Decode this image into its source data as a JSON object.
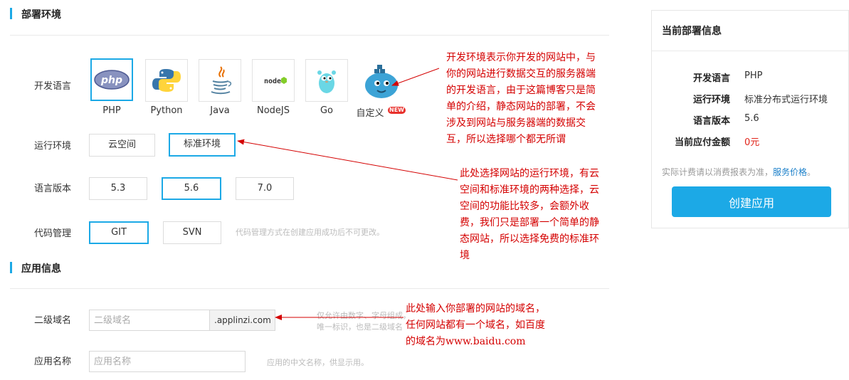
{
  "deploy": {
    "title": "部署环境",
    "language": {
      "label": "开发语言",
      "options": [
        {
          "name": "PHP",
          "icon": "php-logo-icon",
          "selected": true
        },
        {
          "name": "Python",
          "icon": "python-logo-icon",
          "selected": false
        },
        {
          "name": "Java",
          "icon": "java-logo-icon",
          "selected": false
        },
        {
          "name": "NodeJS",
          "icon": "nodejs-logo-icon",
          "selected": false
        },
        {
          "name": "Go",
          "icon": "go-gopher-icon",
          "selected": false
        },
        {
          "name": "自定义",
          "icon": "docker-whale-icon",
          "selected": false,
          "badge": "NEW"
        }
      ]
    },
    "runtime": {
      "label": "运行环境",
      "options": [
        {
          "name": "云空间",
          "selected": false
        },
        {
          "name": "标准环境",
          "selected": true
        }
      ]
    },
    "version": {
      "label": "语言版本",
      "options": [
        {
          "name": "5.3",
          "selected": false
        },
        {
          "name": "5.6",
          "selected": true
        },
        {
          "name": "7.0",
          "selected": false
        }
      ]
    },
    "vcs": {
      "label": "代码管理",
      "options": [
        {
          "name": "GIT",
          "selected": true
        },
        {
          "name": "SVN",
          "selected": false
        }
      ],
      "hint": "代码管理方式在创建应用成功后不可更改。"
    }
  },
  "app": {
    "title": "应用信息",
    "domain": {
      "label": "二级域名",
      "placeholder": "二级域名",
      "suffix": ".applinzi.com",
      "hint_line1": "仅允许由数字、字母组成，",
      "hint_line2": "唯一标识，也是二级域名"
    },
    "name": {
      "label": "应用名称",
      "placeholder": "应用名称",
      "hint": "应用的中文名称，供显示用。"
    }
  },
  "summary": {
    "title": "当前部署信息",
    "rows": [
      {
        "label": "开发语言",
        "value": "PHP"
      },
      {
        "label": "运行环境",
        "value": "标准分布式运行环境"
      },
      {
        "label": "语言版本",
        "value": "5.6"
      },
      {
        "label": "当前应付金额",
        "value": "0元"
      }
    ],
    "note_prefix": "实际计费请以消费报表为准，",
    "note_link": "服务价格",
    "note_suffix": "。",
    "create_button": "创建应用"
  },
  "annotations": {
    "lang": [
      "开发环境表示你开发的网站中，与",
      "你的网站进行数据交互的服务器端",
      "的开发语言，由于这篇博客只是简",
      "单的介绍，静态网站的部署，不会",
      "涉及到网站与服务器端的数据交",
      "互，所以选择哪个都无所谓"
    ],
    "runtime": [
      "此处选择网站的运行环境，有云",
      "空间和标准环境的两种选择，云",
      "空间的功能比较多，会额外收",
      "费，我们只是部署一个简单的静",
      "态网站，所以选择免费的标准环",
      "境"
    ],
    "domain": [
      "此处输入你部署的网站的域名，",
      "任何网站都有一个域名，如百度",
      "的域名为www.baidu.com"
    ]
  },
  "colors": {
    "accent": "#1ca9e6",
    "annotation": "#d40000",
    "price": "#e1251b",
    "link": "#1a7fc9"
  }
}
